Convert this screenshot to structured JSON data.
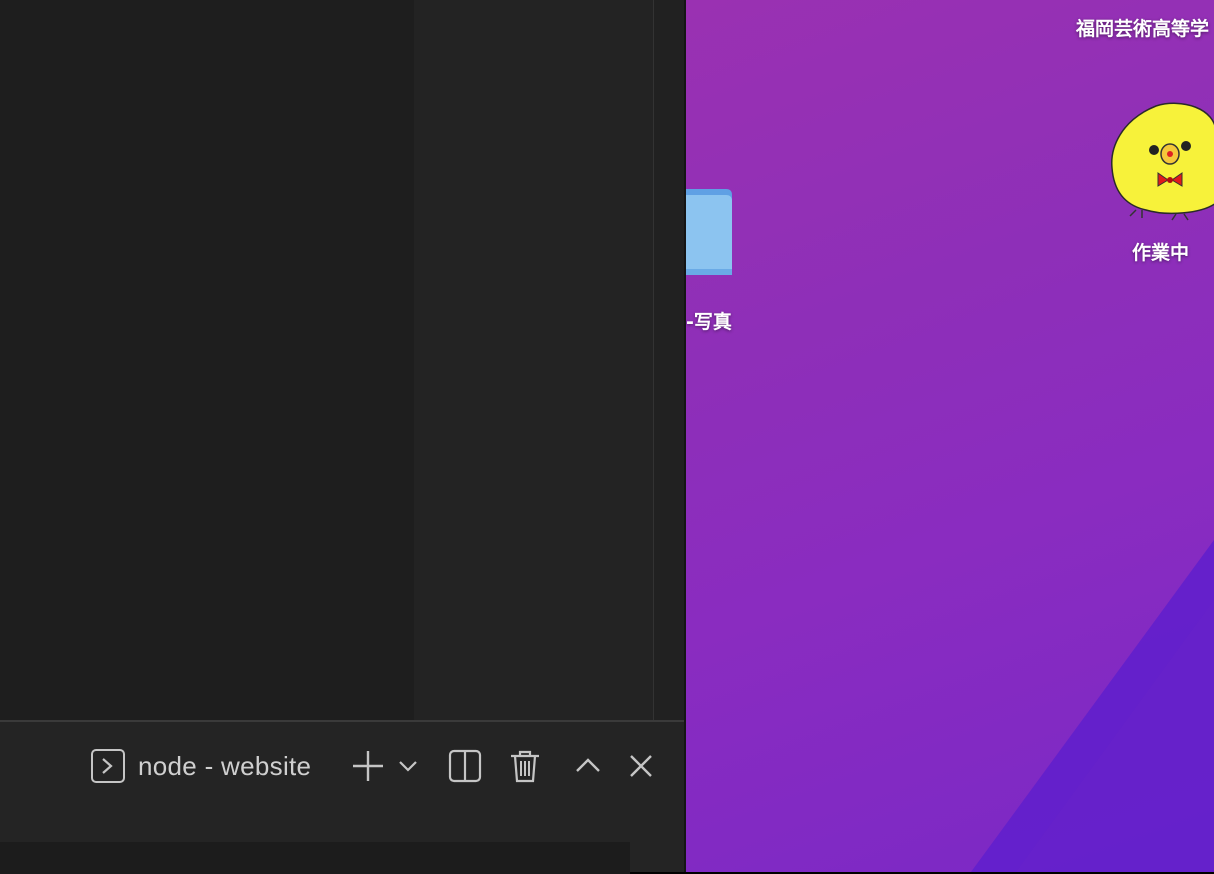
{
  "desktop": {
    "top_label": "福岡芸術高等学",
    "folder_label": "-写真",
    "chick_label": "作業中"
  },
  "terminal_panel": {
    "tab_label": "node - website",
    "icons": [
      "terminal-icon",
      "plus-icon",
      "chevron-down-icon",
      "split-icon",
      "trash-icon",
      "chevron-up-icon",
      "close-icon"
    ]
  }
}
